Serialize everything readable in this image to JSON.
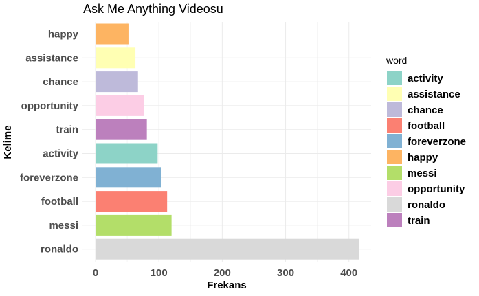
{
  "chart_data": {
    "type": "bar",
    "orientation": "horizontal",
    "title": "Ask Me Anything Videosu",
    "xlabel": "Frekans",
    "ylabel": "Kelime",
    "xlim": [
      0,
      420
    ],
    "xticks": [
      0,
      100,
      200,
      300,
      400
    ],
    "grid": true,
    "categories": [
      "happy",
      "assistance",
      "chance",
      "opportunity",
      "train",
      "activity",
      "foreverzone",
      "football",
      "messi",
      "ronaldo"
    ],
    "values": [
      52,
      63,
      67,
      77,
      81,
      98,
      104,
      113,
      120,
      416
    ],
    "legend": {
      "title": "word",
      "position": "right",
      "entries": [
        "activity",
        "assistance",
        "chance",
        "football",
        "foreverzone",
        "happy",
        "messi",
        "opportunity",
        "ronaldo",
        "train"
      ]
    },
    "colors": {
      "activity": "#8dd3c7",
      "assistance": "#ffffb3",
      "chance": "#bebada",
      "football": "#fb8072",
      "foreverzone": "#80b1d3",
      "happy": "#fdb462",
      "messi": "#b3de69",
      "opportunity": "#fccde5",
      "ronaldo": "#d9d9d9",
      "train": "#bc80bd"
    }
  }
}
